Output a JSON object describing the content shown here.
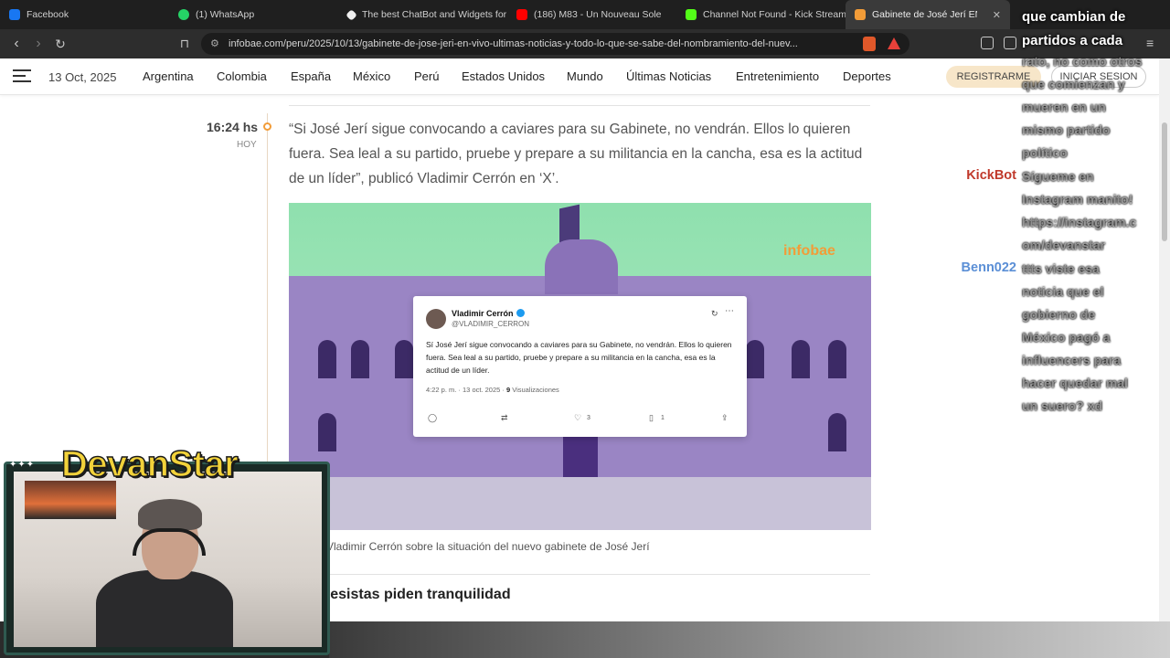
{
  "browser": {
    "tabs": [
      {
        "label": "Facebook",
        "color": "#1877f2"
      },
      {
        "label": "(1) WhatsApp",
        "color": "#25d366"
      },
      {
        "label": "The best ChatBot and Widgets for",
        "color": "#f0f0f0"
      },
      {
        "label": "(186) M83 - Un Nouveau Sole",
        "color": "#ff0000"
      },
      {
        "label": "Channel Not Found - Kick Stream",
        "color": "#53fc18"
      },
      {
        "label": "Gabinete de José Jerí EN VIVO",
        "color": "#f29c38",
        "close": "✕"
      }
    ],
    "url": "infobae.com/peru/2025/10/13/gabinete-de-jose-jeri-en-vivo-ultimas-noticias-y-todo-lo-que-se-sabe-del-nombramiento-del-nuev..."
  },
  "site": {
    "date": "13 Oct, 2025",
    "nav": [
      "Argentina",
      "Colombia",
      "España",
      "México",
      "Perú",
      "Estados Unidos",
      "Mundo",
      "Últimas Noticias",
      "Entretenimiento",
      "Deportes"
    ],
    "register": "REGISTRARME",
    "login": "INICIAR SESION"
  },
  "entry": {
    "time": "16:24 hs",
    "day": "HOY",
    "quote": "“Si José Jerí sigue convocando a caviares para su Gabinete, no vendrán. Ellos lo quieren fuera. Sea leal a su partido, pruebe y prepare a su militancia en la cancha, esa es la actitud de un líder”, publicó Vladimir Cerrón en ‘X’.",
    "photo_logo": "infobae",
    "caption": "Vladimir Cerrón sobre la situación del nuevo gabinete de José Jerí",
    "next_heading": "resistas piden tranquilidad"
  },
  "tweet": {
    "name": "Vladimir Cerrón",
    "handle": "@VLADIMIR_CERRON",
    "body": "Sí José Jerí sigue convocando a caviares para su Gabinete, no vendrán. Ellos lo quieren fuera. Sea leal a su partido, pruebe y prepare a su militancia en la cancha, esa es la actitud de un líder.",
    "timestamp": "4:22 p. m. · 13 oct. 2025 · ",
    "views_count": "9",
    "views_label": " Visualizaciones",
    "likes": "3",
    "bookmarks": "1"
  },
  "chat": {
    "first": "que cambian de partidos a cada",
    "lines_a": [
      "rato, no como otros",
      "que comienzan y",
      "mueren en un",
      "mismo partido",
      "político"
    ],
    "user2": {
      "name": "KickBot",
      "color": "#c0392b"
    },
    "lines_b": [
      "Sígueme en",
      "Instagram manito!",
      "https://instagram.c",
      "om/devanstar"
    ],
    "user3": {
      "name": "Benn022",
      "color": "#5b8fd6"
    },
    "lines_c": [
      "ttts viste esa",
      "noticia que el",
      "gobierno de",
      "México pagó a",
      "influencers para",
      "hacer quedar mal",
      "un suero? xd"
    ]
  },
  "stream": {
    "title": "DevanStar",
    "stars": "✦✦✦"
  }
}
